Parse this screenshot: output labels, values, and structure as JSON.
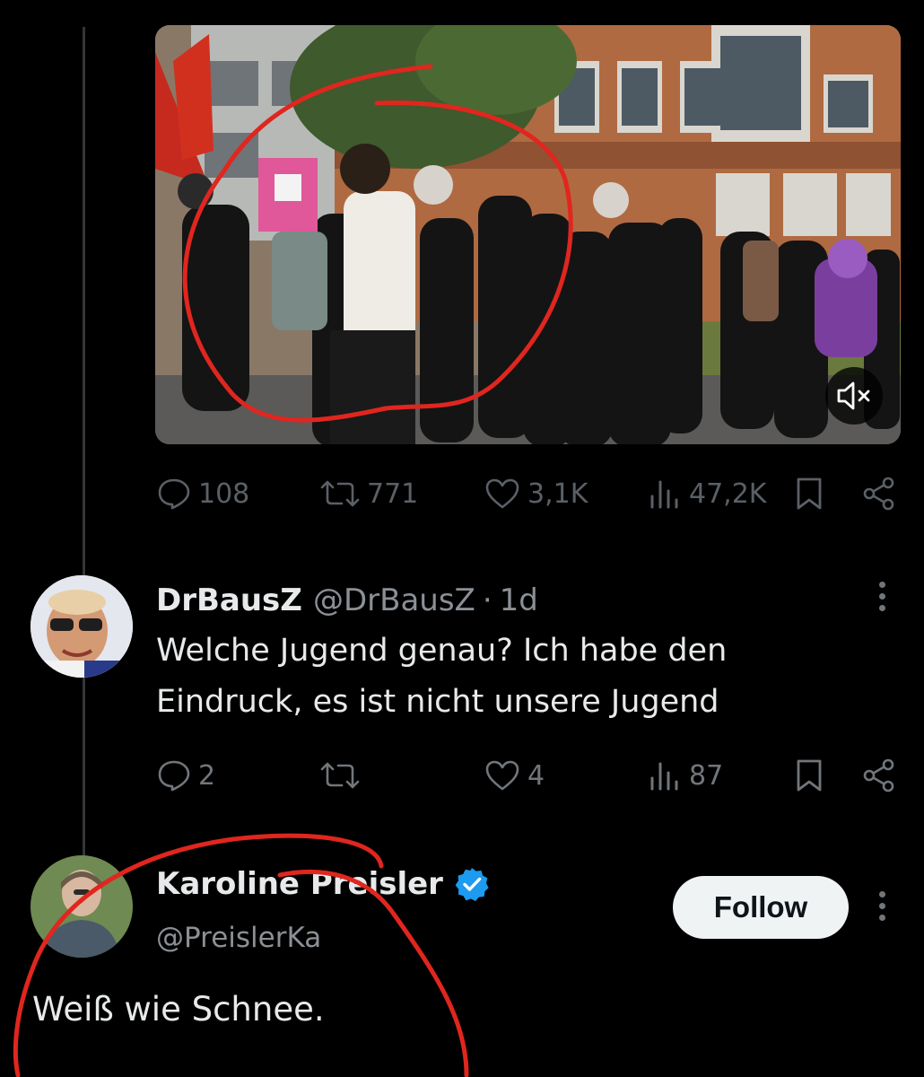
{
  "tweet": {
    "stats": {
      "replies": "108",
      "reposts": "771",
      "likes": "3,1K",
      "views": "47,2K"
    }
  },
  "replies": [
    {
      "name": "DrBausZ",
      "handle": "@DrBausZ",
      "separator": "·",
      "time": "1d",
      "text_line1": "Welche Jugend genau? Ich habe den",
      "text_line2": "Eindruck, es ist nicht unsere Jugend",
      "stats": {
        "replies": "2",
        "likes": "4",
        "views": "87"
      }
    },
    {
      "name": "Karoline Preisler",
      "verified": true,
      "handle": "@PreislerKa",
      "follow_label": "Follow",
      "text": "Weiß wie Schnee."
    }
  ],
  "colors": {
    "background": "#000000",
    "text": "#e7e9ea",
    "muted": "#71767b",
    "verified_blue": "#1d9bf0",
    "annotation_red": "#e0261f"
  },
  "icons": [
    "reply-icon",
    "repost-icon",
    "like-icon",
    "views-icon",
    "bookmark-icon",
    "share-icon",
    "more-icon",
    "mute-icon",
    "verified-icon"
  ]
}
